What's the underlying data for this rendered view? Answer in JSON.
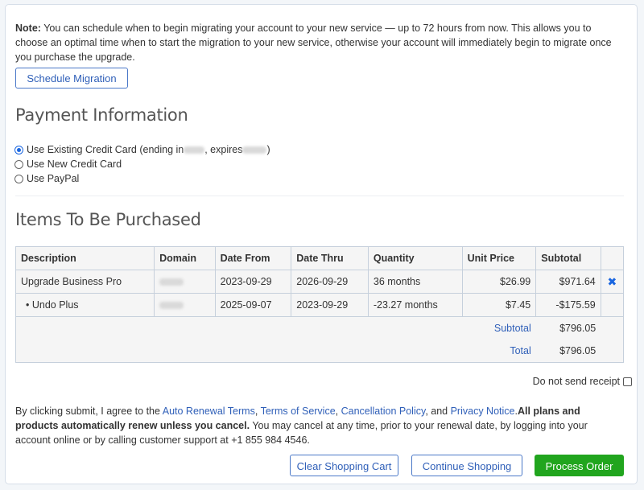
{
  "note": {
    "label": "Note:",
    "text": " You can schedule when to begin migrating your account to your new service — up to 72 hours from now. This allows you to choose an optimal time when to start the migration to your new service, otherwise your account will immediately begin to migrate once you purchase the upgrade."
  },
  "schedule_button": "Schedule Migration",
  "payment": {
    "title": "Payment Information",
    "options": [
      {
        "prefix": "Use Existing Credit Card (ending in ",
        "middle": ", expires ",
        "suffix": ")",
        "checked": true
      },
      {
        "label": "Use New Credit Card",
        "checked": false
      },
      {
        "label": "Use PayPal",
        "checked": false
      }
    ]
  },
  "items": {
    "title": "Items To Be Purchased",
    "columns": [
      "Description",
      "Domain",
      "Date From",
      "Date Thru",
      "Quantity",
      "Unit Price",
      "Subtotal"
    ],
    "rows": [
      {
        "description": "Upgrade Business Pro",
        "date_from": "2023-09-29",
        "date_thru": "2026-09-29",
        "quantity": "36 months",
        "unit_price": "$26.99",
        "subtotal": "$971.64",
        "remove_icon": "✖"
      },
      {
        "description": "• Undo Plus",
        "date_from": "2025-09-07",
        "date_thru": "2023-09-29",
        "quantity": "-23.27 months",
        "unit_price": "$7.45",
        "subtotal": "-$175.59"
      }
    ],
    "subtotal_label": "Subtotal",
    "subtotal_value": "$796.05",
    "total_label": "Total",
    "total_value": "$796.05"
  },
  "receipt_label": "Do not send receipt",
  "agreement": {
    "intro": "By clicking submit, I agree to the ",
    "links": [
      "Auto Renewal Terms",
      "Terms of Service",
      "Cancellation Policy",
      "Privacy Notice"
    ],
    "sep1": ", ",
    "sep2": ", ",
    "sep3": ", and ",
    "bold": "All plans and products automatically renew unless you cancel.",
    "rest": " You may cancel at any time, prior to your renewal date, by logging into your account online or by calling customer support at +1 855 984 4546."
  },
  "buttons": {
    "clear": "Clear Shopping Cart",
    "continue": "Continue Shopping",
    "process": "Process Order"
  },
  "colors": {
    "accent": "#2f5fb8",
    "process_button": "#21a51e"
  }
}
